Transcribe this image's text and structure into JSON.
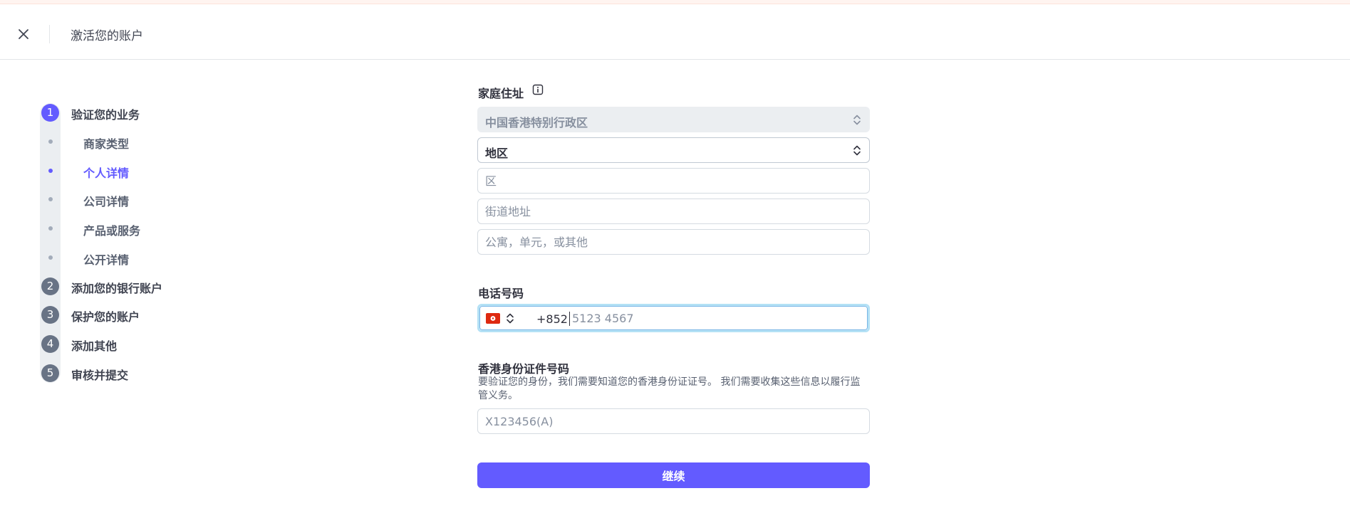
{
  "header": {
    "close_icon": "close-icon",
    "title": "激活您的账户"
  },
  "sidebar": {
    "steps": [
      {
        "num": "1",
        "label": "验证您的业务",
        "active": true
      },
      {
        "num": "2",
        "label": "添加您的银行账户",
        "active": false
      },
      {
        "num": "3",
        "label": "保护您的账户",
        "active": false
      },
      {
        "num": "4",
        "label": "添加其他",
        "active": false
      },
      {
        "num": "5",
        "label": "审核并提交",
        "active": false
      }
    ],
    "substeps": [
      {
        "label": "商家类型",
        "active": false
      },
      {
        "label": "个人详情",
        "active": true
      },
      {
        "label": "公司详情",
        "active": false
      },
      {
        "label": "产品或服务",
        "active": false
      },
      {
        "label": "公开详情",
        "active": false
      }
    ]
  },
  "form": {
    "address": {
      "label": "家庭住址",
      "info_icon": "info-icon",
      "country": "中国香港特别行政区",
      "region": "地区",
      "district_placeholder": "区",
      "street_placeholder": "街道地址",
      "unit_placeholder": "公寓，单元，或其他"
    },
    "phone": {
      "label": "电话号码",
      "flag_icon": "hong-kong-flag-icon",
      "prefix": "+852",
      "placeholder": "5123 4567"
    },
    "hkid": {
      "label": "香港身份证件号码",
      "help": "要验证您的身份，我们需要知道您的香港身份证证号。 我们需要收集这些信息以履行监管义务。",
      "placeholder": "X123456(A)"
    },
    "continue_label": "继续"
  },
  "colors": {
    "accent": "#635bff",
    "focus_ring": "#b4e1f5",
    "step_inactive": "#687385"
  }
}
